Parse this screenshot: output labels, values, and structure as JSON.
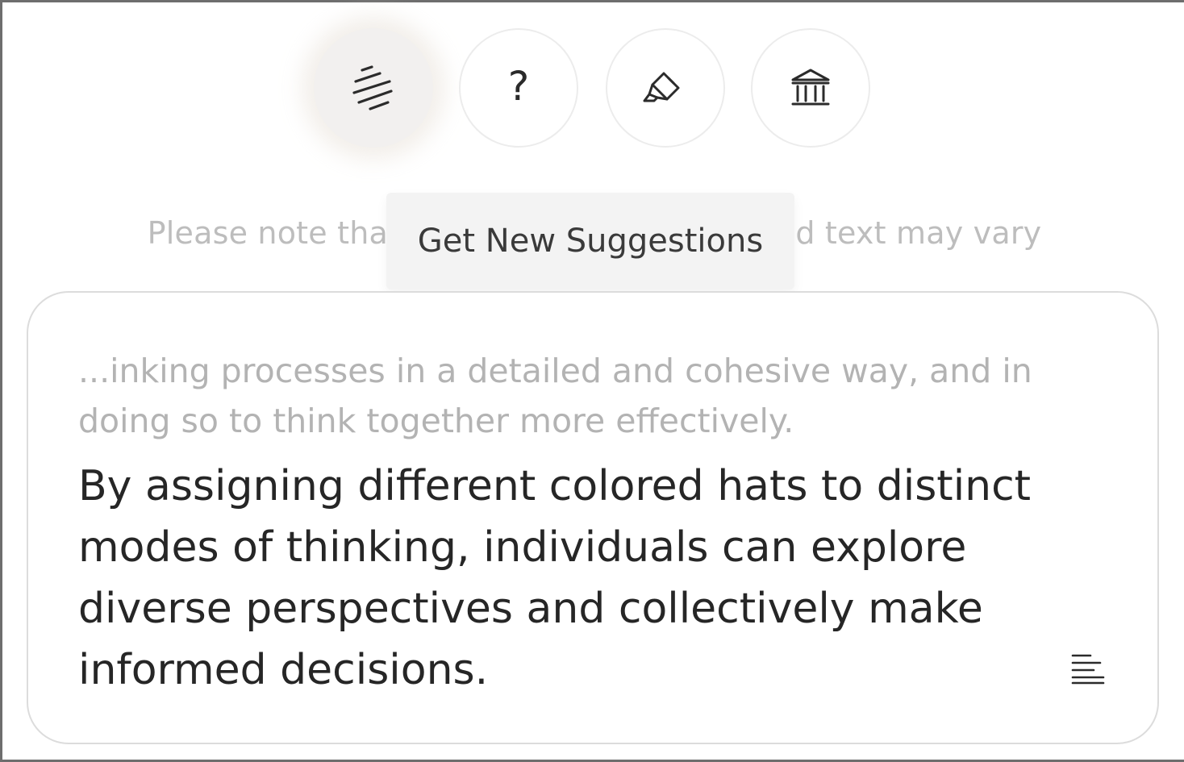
{
  "toolbar": {
    "buttons": [
      {
        "name": "get-new-suggestions",
        "icon": "lines-slanted-icon",
        "active": true
      },
      {
        "name": "help",
        "icon": "question-mark-icon",
        "glyph": "?"
      },
      {
        "name": "highlight",
        "icon": "highlighter-icon"
      },
      {
        "name": "formal",
        "icon": "bank-building-icon"
      }
    ]
  },
  "tooltip": {
    "label": "Get New Suggestions"
  },
  "note": {
    "text": "Please note that the style of the generated text may vary"
  },
  "panel": {
    "context_text": "...inking processes in a detailed and cohesive way, and in doing so to think together more effectively.",
    "suggestion_text": "By assigning different colored hats to distinct modes of thinking, individuals can explore diverse perspectives and collectively make informed decisions.",
    "align_icon": "align-left-icon"
  },
  "colors": {
    "accent_shadow": "#eee8e2",
    "border": "#dcdcdc",
    "muted_text": "#b3b3b3",
    "main_text": "#262626"
  }
}
